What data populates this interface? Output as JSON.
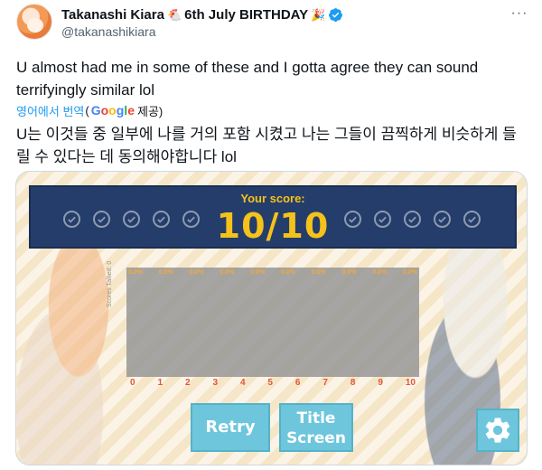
{
  "tweet": {
    "display_name": "Takanashi Kiara",
    "name_emoji": "🐔",
    "name_suffix": "6th July BIRTHDAY",
    "party_emoji": "🎉",
    "handle": "@takanashikiara",
    "more_label": "···",
    "text": "U almost had me in some of these and I gotta agree they can sound terrifyingly similar lol",
    "translate_link": "영어에서 번역",
    "translate_by_prefix": "(",
    "google_letters": [
      "G",
      "o",
      "o",
      "g",
      "l",
      "e"
    ],
    "translate_by_suffix": " 제공)",
    "translated_text": "U는 이것들 중 일부에 나를 거의 포함 시켰고 나는 그들이 끔찍하게 비슷하게 들릴 수 있다는 데 동의해야합니다 lol"
  },
  "game": {
    "score_label": "Your score:",
    "score_value": "10/10",
    "checks_left_count": 5,
    "checks_right_count": 5,
    "graph_percents": [
      "0.0%",
      "0.0%",
      "0.0%",
      "0.0%",
      "0.0%",
      "0.0%",
      "0.0%",
      "0.0%",
      "0.0%",
      "0.0%"
    ],
    "graph_axis_label": "Scores Tallied: 0",
    "x_ticks": [
      "0",
      "1",
      "2",
      "3",
      "4",
      "5",
      "6",
      "7",
      "8",
      "9",
      "10"
    ],
    "retry_label": "Retry",
    "title_screen_line1": "Title",
    "title_screen_line2": "Screen",
    "gear_icon": "gear-icon"
  },
  "colors": {
    "banner": "#253d6b",
    "score_gold": "#f4c21a",
    "button_blue": "#6dc6dc",
    "link_blue": "#1d9bf0",
    "verified_blue": "#1d9bf0"
  }
}
